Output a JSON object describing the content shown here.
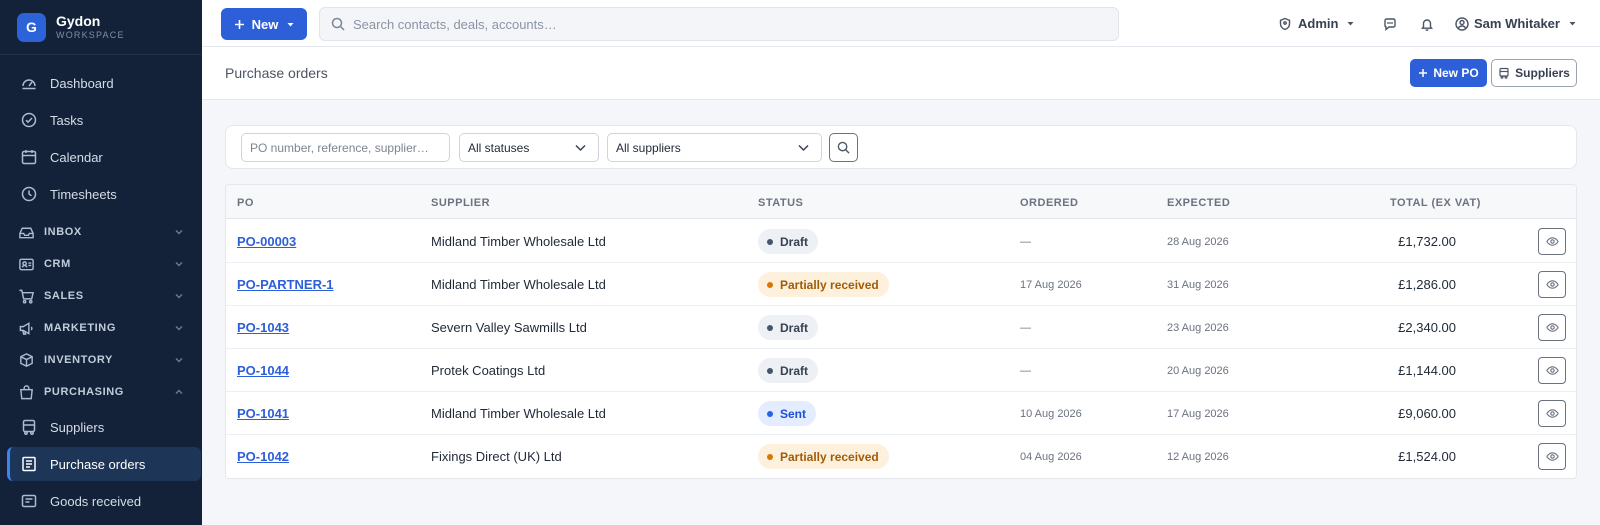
{
  "brand": {
    "initial": "G",
    "name": "Gydon",
    "subtitle": "WORKSPACE"
  },
  "sidebar": {
    "items": [
      {
        "label": "Dashboard",
        "icon": "dashboard-icon"
      },
      {
        "label": "Tasks",
        "icon": "check-circle-icon"
      },
      {
        "label": "Calendar",
        "icon": "calendar-icon"
      },
      {
        "label": "Timesheets",
        "icon": "clock-icon"
      }
    ],
    "sections": [
      {
        "label": "INBOX",
        "icon": "inbox-icon",
        "expanded": false
      },
      {
        "label": "CRM",
        "icon": "contact-card-icon",
        "expanded": false
      },
      {
        "label": "SALES",
        "icon": "cart-icon",
        "expanded": false
      },
      {
        "label": "MARKETING",
        "icon": "megaphone-icon",
        "expanded": false
      },
      {
        "label": "INVENTORY",
        "icon": "boxes-icon",
        "expanded": false
      },
      {
        "label": "PURCHASING",
        "icon": "bag-icon",
        "expanded": true
      }
    ],
    "purchasing_items": [
      {
        "label": "Suppliers",
        "icon": "truck-icon",
        "active": false
      },
      {
        "label": "Purchase orders",
        "icon": "receipt-icon",
        "active": true
      },
      {
        "label": "Goods received",
        "icon": "inbox-tray-icon",
        "active": false
      }
    ]
  },
  "topbar": {
    "new_label": "New",
    "search_placeholder": "Search contacts, deals, accounts…",
    "role_label": "Admin",
    "user_name": "Sam Whitaker"
  },
  "page": {
    "title": "Purchase orders",
    "new_po_label": "New PO",
    "suppliers_label": "Suppliers"
  },
  "filters": {
    "search_placeholder": "PO number, reference, supplier…",
    "status_selected": "All statuses",
    "supplier_selected": "All suppliers"
  },
  "table": {
    "columns": {
      "po": "PO",
      "supplier": "SUPPLIER",
      "status": "STATUS",
      "ordered": "ORDERED",
      "expected": "EXPECTED",
      "total": "TOTAL (EX VAT)"
    },
    "rows": [
      {
        "po": "PO-00003",
        "supplier": "Midland Timber Wholesale Ltd",
        "status": "Draft",
        "status_kind": "draft",
        "ordered": "—",
        "expected": "28 Aug 2026",
        "total": "£1,732.00"
      },
      {
        "po": "PO-PARTNER-1",
        "supplier": "Midland Timber Wholesale Ltd",
        "status": "Partially received",
        "status_kind": "partial",
        "ordered": "17 Aug 2026",
        "expected": "31 Aug 2026",
        "total": "£1,286.00"
      },
      {
        "po": "PO-1043",
        "supplier": "Severn Valley Sawmills Ltd",
        "status": "Draft",
        "status_kind": "draft",
        "ordered": "—",
        "expected": "23 Aug 2026",
        "total": "£2,340.00"
      },
      {
        "po": "PO-1044",
        "supplier": "Protek Coatings Ltd",
        "status": "Draft",
        "status_kind": "draft",
        "ordered": "—",
        "expected": "20 Aug 2026",
        "total": "£1,144.00"
      },
      {
        "po": "PO-1041",
        "supplier": "Midland Timber Wholesale Ltd",
        "status": "Sent",
        "status_kind": "sent",
        "ordered": "10 Aug 2026",
        "expected": "17 Aug 2026",
        "total": "£9,060.00"
      },
      {
        "po": "PO-1042",
        "supplier": "Fixings Direct (UK) Ltd",
        "status": "Partially received",
        "status_kind": "partial",
        "ordered": "04 Aug 2026",
        "expected": "12 Aug 2026",
        "total": "£1,524.00"
      }
    ]
  },
  "colors": {
    "sidebar_bg": "#132238",
    "primary": "#2d5fd9",
    "draft": "#475569",
    "partial": "#d97706",
    "sent": "#2563eb"
  }
}
